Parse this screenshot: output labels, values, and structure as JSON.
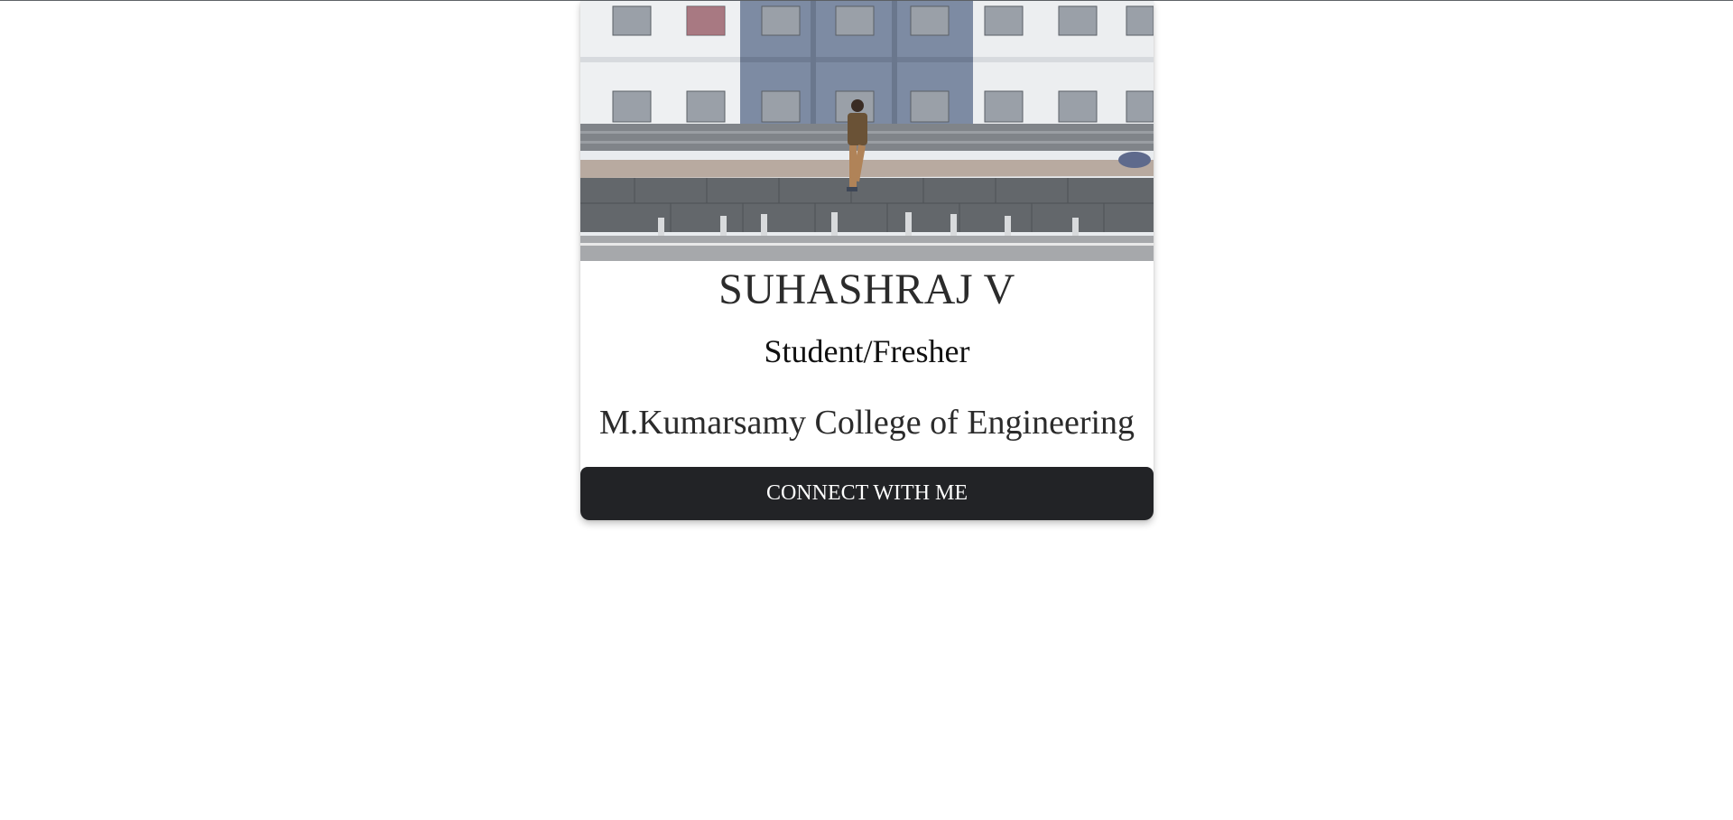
{
  "profile": {
    "name": "SUHASHRAJ V",
    "role": "Student/Fresher",
    "college": "M.Kumarsamy College of Engineering",
    "photo_alt": "Profile photo of SUHASHRAJ V",
    "connect_label": "CONNECT WITH ME"
  },
  "colors": {
    "button_bg": "#222326",
    "button_text": "#ffffff",
    "name_text": "#2b2b2b"
  }
}
